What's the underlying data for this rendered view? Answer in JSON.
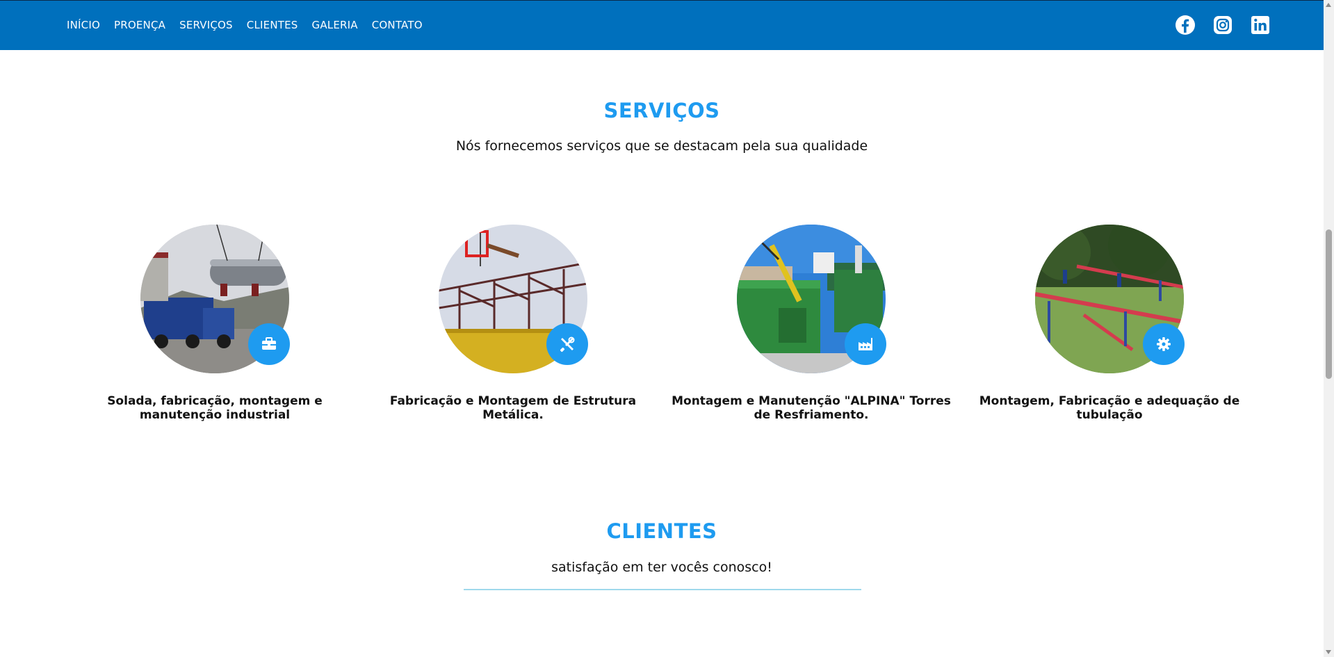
{
  "nav": {
    "items": [
      "INÍCIO",
      "PROENÇA",
      "SERVIÇOS",
      "CLIENTES",
      "GALERIA",
      "CONTATO"
    ],
    "background_color": "#0070bd"
  },
  "social": [
    "facebook-icon",
    "instagram-icon",
    "linkedin-icon"
  ],
  "services": {
    "title": "SERVIÇOS",
    "subtitle": "Nós fornecemos serviços que se destacam pela sua qualidade",
    "items": [
      {
        "title": "Solada, fabricação, montagem e manutenção industrial",
        "icon": "toolbox-icon"
      },
      {
        "title": "Fabricação e Montagem de Estrutura Metálica.",
        "icon": "tools-icon"
      },
      {
        "title": "Montagem e Manutenção \"ALPINA\" Torres de Resfriamento.",
        "icon": "factory-icon"
      },
      {
        "title": "Montagem, Fabricação e adequação de tubulação",
        "icon": "gear-icon"
      }
    ]
  },
  "clients": {
    "title": "CLIENTES",
    "subtitle": "satisfação em ter vocês conosco!"
  },
  "colors": {
    "accent": "#1e9bf0",
    "divider": "#9fd9ec"
  }
}
